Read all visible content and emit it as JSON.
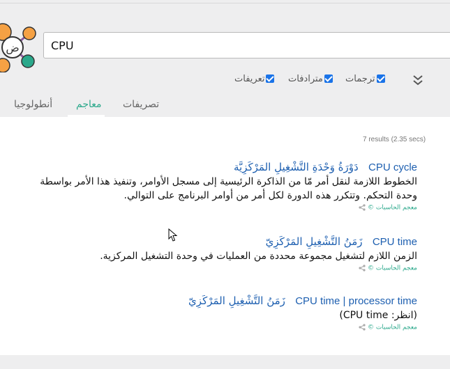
{
  "search": {
    "query": "CPU"
  },
  "filters": {
    "translations": "ترجمات",
    "synonyms": "مترادفات",
    "definitions": "تعريفات"
  },
  "tabs": {
    "morphology": "تصريفات",
    "dictionaries": "معاجم",
    "ontology": "أنطولوجيا"
  },
  "results_count": "7 results (2.35 secs)",
  "results": [
    {
      "en": "CPU cycle",
      "ar": "دَوْرَةُ وَحْدَةِ التَّشْغِيلِ المَرْكَزِيَّة",
      "desc": "الخطوط اللازمة لنقل أمر مّا من الذاكرة الرئيسية إلى مسجل الأوامر، وتنفيذ هذا الأمر بواسطة وحدة التحكم. وتتكرر هذه الدورة لكل أمر من أوامر البرنامج على التوالي.",
      "source": "معجم الحاسبات ©"
    },
    {
      "en": "CPU time",
      "ar": "زَمَنُ التَّشْغِيلِ المَرْكَزِيّ",
      "desc": "الزمن اللازم لتشغيل مجموعة محددة من العمليات في وحدة التشغيل المركزية.",
      "source": "معجم الحاسبات ©"
    },
    {
      "en": "CPU time | processor time",
      "ar": "زَمَنُ التَّشْغِيلِ المَرْكَزِيّ",
      "desc": "(انظر: CPU time)",
      "source": "معجم الحاسبات ©"
    }
  ],
  "logo": {
    "letter": "ض"
  },
  "colors": {
    "accent": "#2aa88b",
    "link": "#1d5fb0",
    "logo_orange": "#f5a144",
    "logo_teal": "#2aa88b"
  }
}
